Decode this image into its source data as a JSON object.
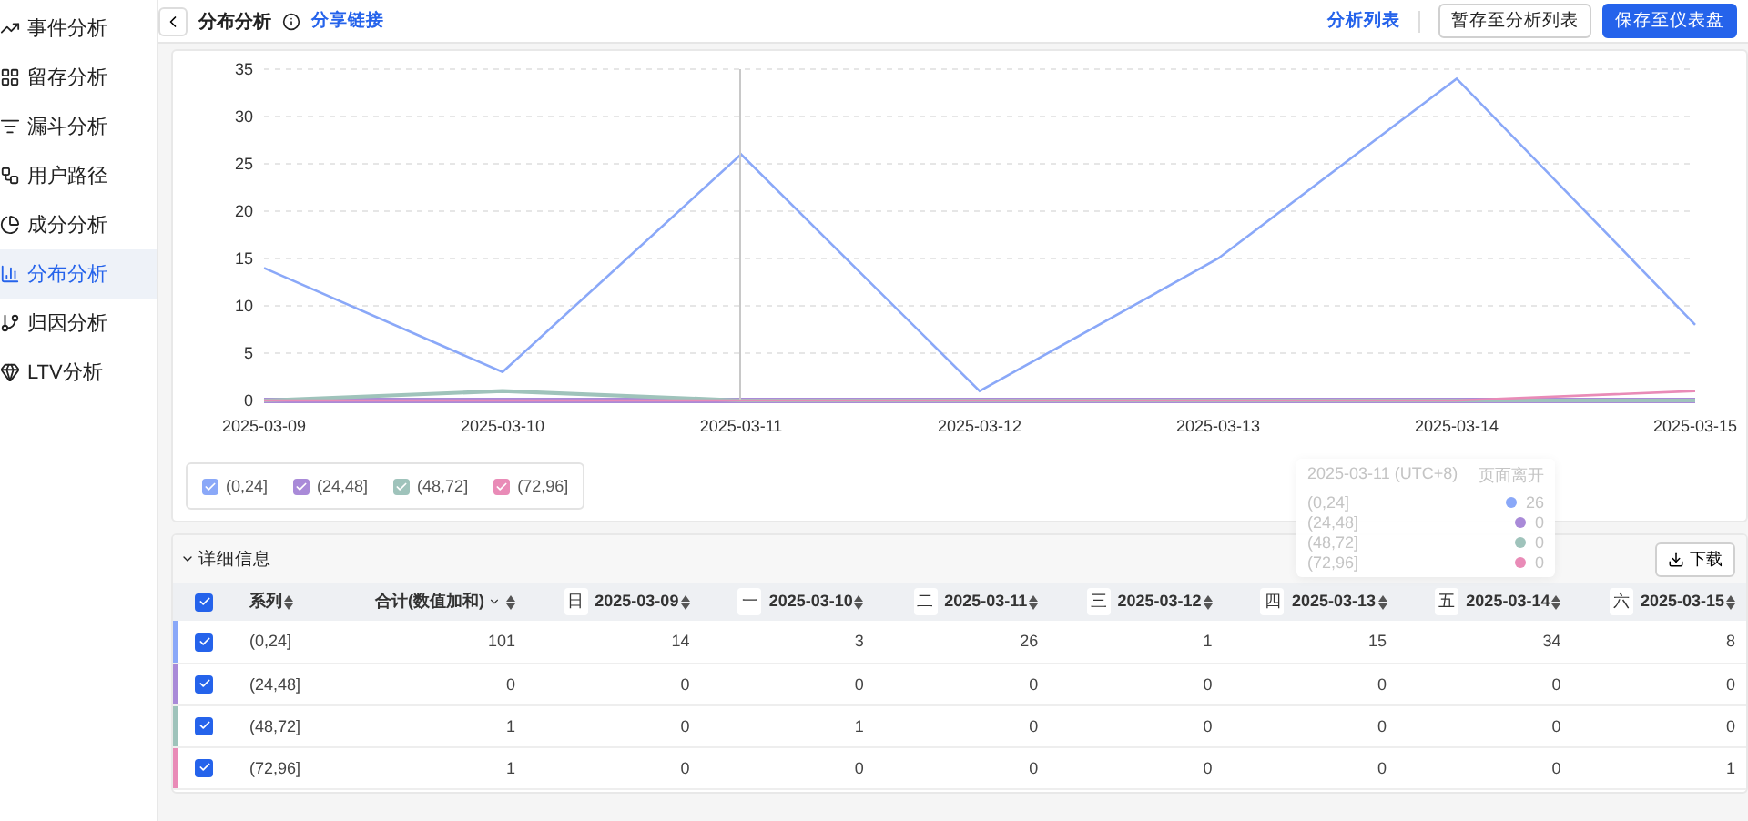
{
  "sidebar": {
    "items": [
      {
        "label": "事件分析",
        "selected": false
      },
      {
        "label": "留存分析",
        "selected": false
      },
      {
        "label": "漏斗分析",
        "selected": false
      },
      {
        "label": "用户路径",
        "selected": false
      },
      {
        "label": "成分分析",
        "selected": false
      },
      {
        "label": "分布分析",
        "selected": true
      },
      {
        "label": "归因分析",
        "selected": false
      },
      {
        "label": "LTV分析",
        "selected": false
      }
    ]
  },
  "toolbar": {
    "title": "分布分析",
    "share_link": "分享链接",
    "analysis_list_link": "分析列表",
    "buttons": [
      {
        "label": "暂存至分析列表",
        "kind": "secondary"
      },
      {
        "label": "保存至仪表盘",
        "kind": "primary"
      }
    ]
  },
  "chart": {
    "chart_data": {
      "type": "line",
      "grid": true,
      "categories": [
        "2025-03-09",
        "2025-03-10",
        "2025-03-11",
        "2025-03-12",
        "2025-03-13",
        "2025-03-14",
        "2025-03-15"
      ],
      "ylim": [
        0,
        35
      ],
      "yticks": [
        0,
        5,
        10,
        15,
        20,
        25,
        30,
        35
      ],
      "series": [
        {
          "name": "(0,24]",
          "color": "#8aa8f8",
          "values": [
            14,
            3,
            26,
            1,
            15,
            34,
            8
          ]
        },
        {
          "name": "(24,48]",
          "color": "#a98ad8",
          "values": [
            0,
            0,
            0,
            0,
            0,
            0,
            0
          ]
        },
        {
          "name": "(48,72]",
          "color": "#9fc3bb",
          "values": [
            0,
            1,
            0,
            0,
            0,
            0,
            0
          ]
        },
        {
          "name": "(72,96]",
          "color": "#e98bb7",
          "values": [
            0,
            0,
            0,
            0,
            0,
            0,
            1
          ]
        }
      ]
    },
    "legend": [
      {
        "checked": true
      },
      {
        "checked": true
      },
      {
        "checked": true
      },
      {
        "checked": true
      }
    ],
    "tooltip": {
      "title": "2025-03-11 (UTC+8)",
      "metric": "页面离开",
      "rows": [
        {
          "name": "(0,24]",
          "color": "#8aa8f8",
          "value": "26"
        },
        {
          "name": "(24,48]",
          "color": "#a98ad8",
          "value": "0"
        },
        {
          "name": "(48,72]",
          "color": "#9fc3bb",
          "value": "0"
        },
        {
          "name": "(72,96]",
          "color": "#e98bb7",
          "value": "0"
        }
      ]
    }
  },
  "details": {
    "title": "详细信息",
    "expanded": true,
    "download": "下载",
    "table": {
      "all_checked": true,
      "series_header": "系列",
      "total_header": "合计(数值加和)",
      "columns": [
        {
          "weekday": "日",
          "date": "2025-03-09"
        },
        {
          "weekday": "一",
          "date": "2025-03-10"
        },
        {
          "weekday": "二",
          "date": "2025-03-11"
        },
        {
          "weekday": "三",
          "date": "2025-03-12"
        },
        {
          "weekday": "四",
          "date": "2025-03-13"
        },
        {
          "weekday": "五",
          "date": "2025-03-14"
        },
        {
          "weekday": "六",
          "date": "2025-03-15"
        }
      ],
      "rows": [
        {
          "series": "(0,24]",
          "color": "#8aa8f8",
          "checked": true,
          "total": "101",
          "values": [
            "14",
            "3",
            "26",
            "1",
            "15",
            "34",
            "8"
          ]
        },
        {
          "series": "(24,48]",
          "color": "#a98ad8",
          "checked": true,
          "total": "0",
          "values": [
            "0",
            "0",
            "0",
            "0",
            "0",
            "0",
            "0"
          ]
        },
        {
          "series": "(48,72]",
          "color": "#9fc3bb",
          "checked": true,
          "total": "1",
          "values": [
            "0",
            "1",
            "0",
            "0",
            "0",
            "0",
            "0"
          ]
        },
        {
          "series": "(72,96]",
          "color": "#e98bb7",
          "checked": true,
          "total": "1",
          "values": [
            "0",
            "0",
            "0",
            "0",
            "0",
            "0",
            "1"
          ]
        }
      ]
    }
  }
}
